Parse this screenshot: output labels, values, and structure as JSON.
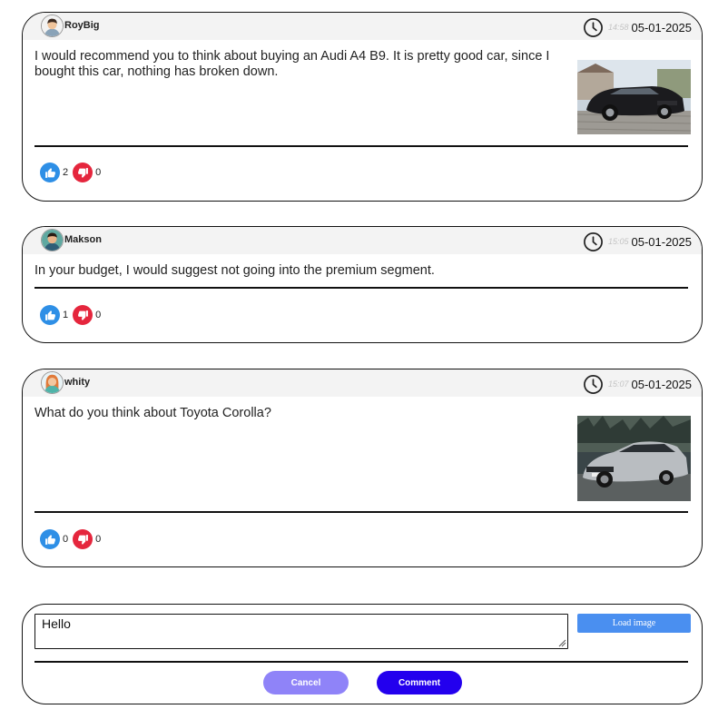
{
  "posts": [
    {
      "username": "RoyBig",
      "time": "14:58",
      "date": "05-01-2025",
      "text": "I would recommend you to think about buying an Audi A4 B9. It is pretty good car, since I bought this car, nothing has broken down.",
      "has_image": true,
      "likes": "2",
      "dislikes": "0"
    },
    {
      "username": "Makson",
      "time": "15:05",
      "date": "05-01-2025",
      "text": "In your budget, I would suggest not going into the premium segment.",
      "has_image": false,
      "likes": "1",
      "dislikes": "0"
    },
    {
      "username": "whity",
      "time": "15:07",
      "date": "05-01-2025",
      "text": "What do you think about Toyota Corolla?",
      "has_image": true,
      "likes": "0",
      "dislikes": "0"
    }
  ],
  "composer": {
    "input_value": "Hello",
    "load_image_label": "Load image",
    "cancel_label": "Cancel",
    "comment_label": "Comment"
  },
  "colors": {
    "like": "#2e8fe6",
    "dislike": "#e5263d",
    "load_image": "#4a8ff0",
    "cancel": "#8f83f8",
    "comment": "#2300ee"
  },
  "icons": [
    "clock-icon",
    "thumbs-up-icon",
    "thumbs-down-icon",
    "avatar",
    "resize-handle-icon"
  ]
}
